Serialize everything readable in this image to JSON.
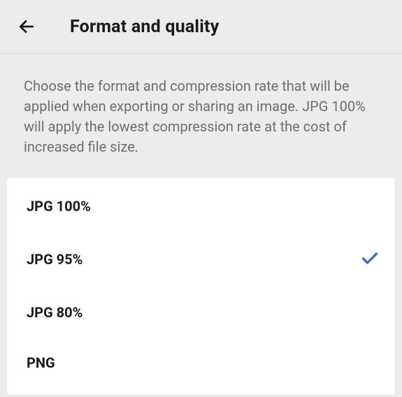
{
  "header": {
    "title": "Format and quality"
  },
  "description": "Choose the format and compression rate that will be applied when exporting or sharing an image. JPG 100% will apply the lowest compression rate at the cost of increased file size.",
  "options": [
    {
      "label": "JPG 100%",
      "selected": false
    },
    {
      "label": "JPG 95%",
      "selected": true
    },
    {
      "label": "JPG 80%",
      "selected": false
    },
    {
      "label": "PNG",
      "selected": false
    }
  ]
}
